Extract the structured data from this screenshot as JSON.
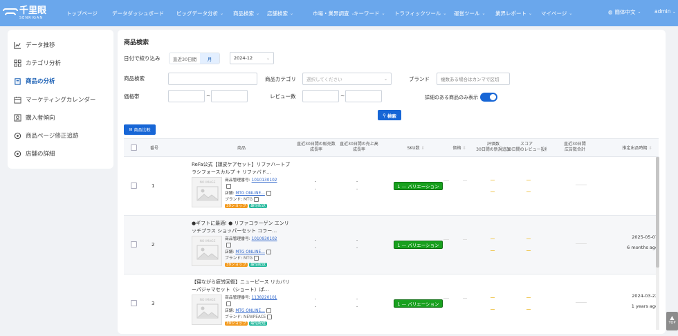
{
  "brand": {
    "name_jp": "千里眼",
    "name_en": "SENRIGAN"
  },
  "nav": [
    {
      "label": "トップページ",
      "dropdown": false
    },
    {
      "label": "データダッシュボード",
      "dropdown": false
    },
    {
      "label": "ビッグデータ分析",
      "dropdown": true
    },
    {
      "label": "商品検索",
      "dropdown": true
    },
    {
      "label": "店舗検索",
      "dropdown": true
    },
    {
      "label": "市場・業界調査",
      "dropdown": true
    },
    {
      "label": "キーワード",
      "dropdown": true
    },
    {
      "label": "トラフィックツール",
      "dropdown": true
    },
    {
      "label": "運営ツール",
      "dropdown": true
    },
    {
      "label": "業界レポート",
      "dropdown": true
    },
    {
      "label": "マイページ",
      "dropdown": true
    }
  ],
  "language": "簡体中文",
  "user": "admin",
  "sidebar": [
    {
      "label": "データ推移",
      "icon": "line-chart-icon",
      "active": false
    },
    {
      "label": "カテゴリ分析",
      "icon": "grid-icon",
      "active": false
    },
    {
      "label": "商品の分析",
      "icon": "clipboard-icon",
      "active": true
    },
    {
      "label": "マーケティングカレンダー",
      "icon": "calendar-icon",
      "active": false
    },
    {
      "label": "購入者傾向",
      "icon": "user-badge-icon",
      "active": false
    },
    {
      "label": "商品ページ修正追跡",
      "icon": "target-icon",
      "active": false
    },
    {
      "label": "店舗の詳細",
      "icon": "target-icon",
      "active": false
    }
  ],
  "search": {
    "title": "商品検索",
    "date_filter_label": "日付で絞り込み",
    "date_segments": [
      "直近30日間",
      "月"
    ],
    "month_value": "2024-12",
    "product_label": "商品検索",
    "category_label": "商品カテゴリ",
    "category_placeholder": "選択してください",
    "brand_label": "ブランド",
    "brand_placeholder": "複数ある場合はカンマで区切",
    "price_label": "価格帯",
    "review_label": "レビュー数",
    "range_sep": "~",
    "detail_only_label": "詳細のある商品のみ表示",
    "search_button": "検索",
    "compare_button": "商品比較"
  },
  "table": {
    "headers": {
      "no": "番号",
      "product": "商品",
      "sales_growth": [
        "直近30日間の販売数",
        "成長率"
      ],
      "revenue_growth": [
        "直近30日間の売上高",
        "成長率"
      ],
      "sku": "SKU数",
      "price": "価格",
      "reviews": [
        "評価数",
        "30日間の新規追加"
      ],
      "score": [
        "スコア",
        "30日間のレビュー投稿"
      ],
      "ad_count": [
        "直近30日間",
        "広告数合計"
      ],
      "listed_date": "推定出品時期"
    },
    "rows": [
      {
        "no": "1",
        "name": "ReFa公式【頭皮ケアセット】リファハートブラシフォースカルプ + リファバド…",
        "mgmt_label": "商品管理番号:",
        "mgmt_no": "1010130102",
        "store_label": "店舗:",
        "store": "MTG ONLINE…",
        "brand_label": "ブランド:",
        "brand": "MTG",
        "tags": [
          "39ショップ",
          "最短配送"
        ],
        "noimage": "NO IMAGE",
        "sku": "1 — バリエーション",
        "date": "",
        "ago": ""
      },
      {
        "no": "2",
        "name": "●ギフトに最適! ● リファコラーゲン エンリッチプラス ショッパーセット コラー…",
        "mgmt_label": "商品管理番号:",
        "mgmt_no": "1010930102",
        "store_label": "店舗:",
        "store": "MTG ONLINE…",
        "brand_label": "ブランド:",
        "brand": "MTG",
        "tags": [
          "39ショップ",
          "最短配送"
        ],
        "noimage": "NO IMAGE",
        "sku": "1 — バリエーション",
        "date": "2025-05-07",
        "ago": "6 months ago"
      },
      {
        "no": "3",
        "name": "【寝ながら疲労回復】ニューピース リカバリーパジャマセット（ショート）ぱ…",
        "mgmt_label": "商品管理番号:",
        "mgmt_no": "1138220101",
        "store_label": "店舗:",
        "store": "MTG ONLINE…",
        "brand_label": "ブランド:",
        "brand": "NEWPEACE",
        "tags": [
          "39ショップ",
          "最短配送"
        ],
        "noimage": "NO IMAGE",
        "sku": "1 — バリエーション",
        "date": "2024-03-22",
        "ago": "1 years ago"
      }
    ],
    "placeholder_dash": "-"
  },
  "to_top": "TOP"
}
